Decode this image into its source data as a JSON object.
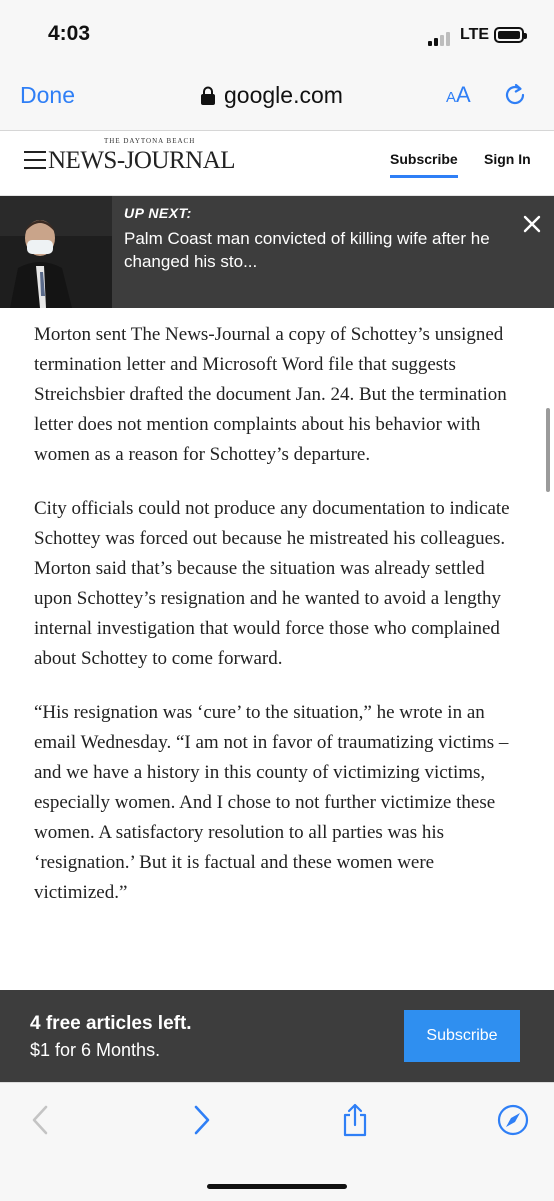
{
  "status_bar": {
    "time": "4:03",
    "network": "LTE"
  },
  "browser": {
    "done_label": "Done",
    "url": "google.com",
    "aa_label": "A",
    "aa_label_big": "A"
  },
  "site": {
    "logo_sub": "THE DAYTONA BEACH",
    "logo": "NEWS-JOURNAL",
    "subscribe": "Subscribe",
    "sign_in": "Sign In"
  },
  "up_next": {
    "label": "UP NEXT:",
    "title": "Palm Coast man convicted of killing wife after he changed his sto..."
  },
  "article": {
    "paragraphs": [
      "Morton sent The News-Journal a copy of Schottey’s unsigned termination letter and Microsoft Word file that suggests Streichsbier drafted the document Jan. 24. But the termination letter does not mention complaints about his behavior with women as a reason for Schottey’s departure.",
      "City officials could not produce any documentation to indicate Schottey was forced out because he mistreated his colleagues. Morton said that’s because the situation was already settled upon Schottey’s resignation and he wanted to avoid a lengthy internal investigation that would force those who complained about Schottey to come forward.",
      "“His resignation was ‘cure’ to the situation,” he wrote in an email Wednesday. “I am not in favor of traumatizing victims – and we have a history in this county of victimizing victims, especially women. And I chose to not further victimize these women. A satisfactory resolution to all parties was his ‘resignation.’ But it is factual and these women were victimized.”"
    ]
  },
  "paywall": {
    "line1": "4 free articles left.",
    "line2": "$1 for 6 Months.",
    "button": "Subscribe"
  },
  "toolbar": {
    "icons": [
      "back-icon",
      "forward-icon",
      "share-icon",
      "compass-icon"
    ]
  },
  "colors": {
    "accent": "#2f7ff6",
    "banner_bg": "#3d3d3d",
    "subscribe_btn": "#2f8ff0"
  }
}
